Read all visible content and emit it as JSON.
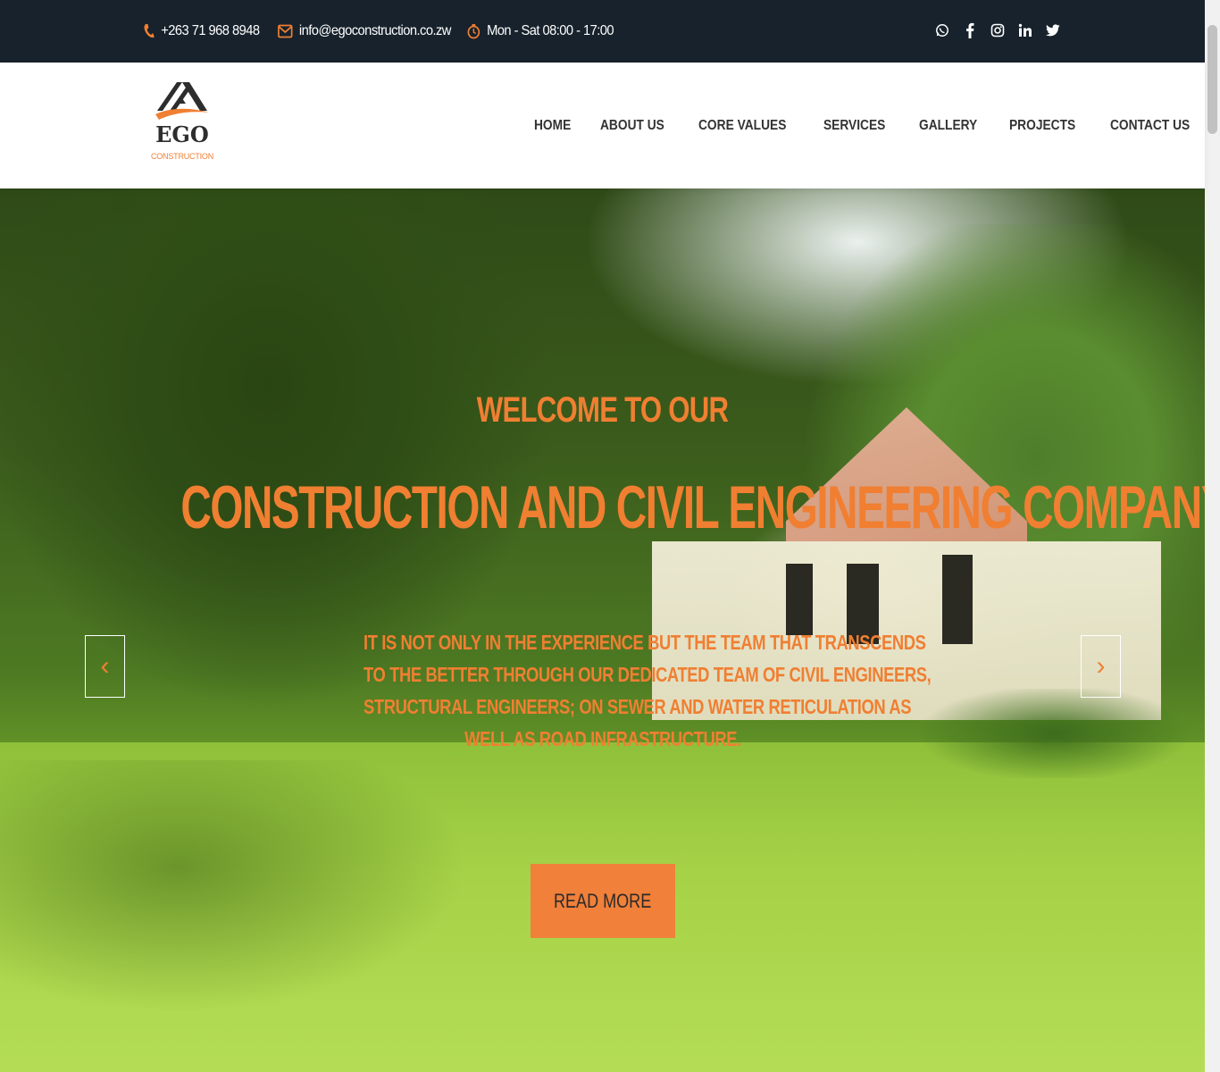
{
  "topbar": {
    "phone": "+263 71 968 8948",
    "email": "info@egoconstruction.co.zw",
    "hours": "Mon - Sat 08:00 - 17:00",
    "icon_color": "#f07f32",
    "background": "#17222c",
    "socials": [
      "whatsapp-icon",
      "facebook-icon",
      "instagram-icon",
      "linkedin-icon",
      "twitter-icon"
    ]
  },
  "header": {
    "logo_text": "EGO",
    "logo_subtext": "CONSTRUCTION",
    "nav": [
      "HOME",
      "ABOUT US",
      "CORE VALUES",
      "SERVICES",
      "GALLERY",
      "PROJECTS",
      "CONTACT US"
    ]
  },
  "hero": {
    "welcome": "WELCOME TO OUR",
    "title": "CONSTRUCTION AND CIVIL ENGINEERING COMPANY",
    "text_lines": [
      "IT IS NOT ONLY IN THE EXPERIENCE BUT THE TEAM THAT TRANSCENDS",
      "TO THE BETTER THROUGH OUR DEDICATED TEAM OF CIVIL ENGINEERS,",
      "STRUCTURAL ENGINEERS; ON SEWER AND WATER RETICULATION AS",
      "WELL AS ROAD INFRASTRUCTURE."
    ],
    "button_label": "READ MORE",
    "prev_arrow": "‹",
    "next_arrow": "›",
    "accent_color": "#f07f32"
  }
}
